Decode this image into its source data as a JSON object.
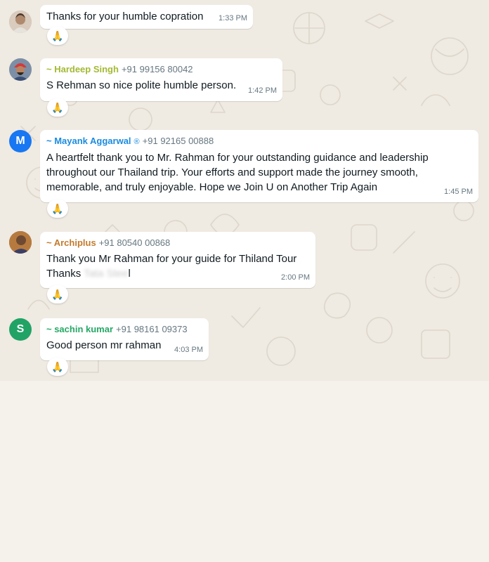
{
  "colors": {
    "chat_background": "#efeae2",
    "bubble": "#ffffff",
    "name_hardeep": "#a4b933",
    "name_mayank": "#1b8be0",
    "name_archiplus": "#c47a2c",
    "name_sachin": "#25a865",
    "avatar_mayank": "#1877f2",
    "avatar_sachin": "#21a366"
  },
  "messages": [
    {
      "text": "Thanks for your humble copration",
      "time": "1:33 PM",
      "reaction": "🙏",
      "avatar_icon": "person-photo-icon"
    },
    {
      "sender_name": "~ Hardeep Singh",
      "sender_phone": "+91 99156 80042",
      "text": "S Rehman so nice polite humble person.",
      "time": "1:42 PM",
      "reaction": "🙏",
      "avatar_icon": "turban-person-photo-icon"
    },
    {
      "sender_name": "~ Mayank Aggarwal",
      "sender_badge": "®",
      "sender_phone": "+91 92165 00888",
      "text": "A heartfelt thank you to Mr. Rahman for your outstanding guidance and leadership throughout our Thailand trip. Your efforts and support made the journey smooth, memorable, and truly enjoyable. Hope we Join U on Another Trip Again",
      "time": "1:45 PM",
      "reaction": "🙏",
      "avatar_letter": "M"
    },
    {
      "sender_name": "~ Archiplus",
      "sender_phone": "+91 80540 00868",
      "text_line1": "Thank you Mr Rahman for your guide for Thiland Tour",
      "text_line2_start": "Thanks ",
      "text_line2_blurred": "Tata Stee",
      "text_line2_end": "l",
      "time": "2:00 PM",
      "reaction": "🙏",
      "avatar_icon": "person-photo-icon"
    },
    {
      "sender_name": "~ sachin kumar",
      "sender_phone": "+91 98161 09373",
      "text": "Good person mr rahman",
      "time": "4:03 PM",
      "reaction": "🙏",
      "avatar_letter": "S"
    }
  ]
}
